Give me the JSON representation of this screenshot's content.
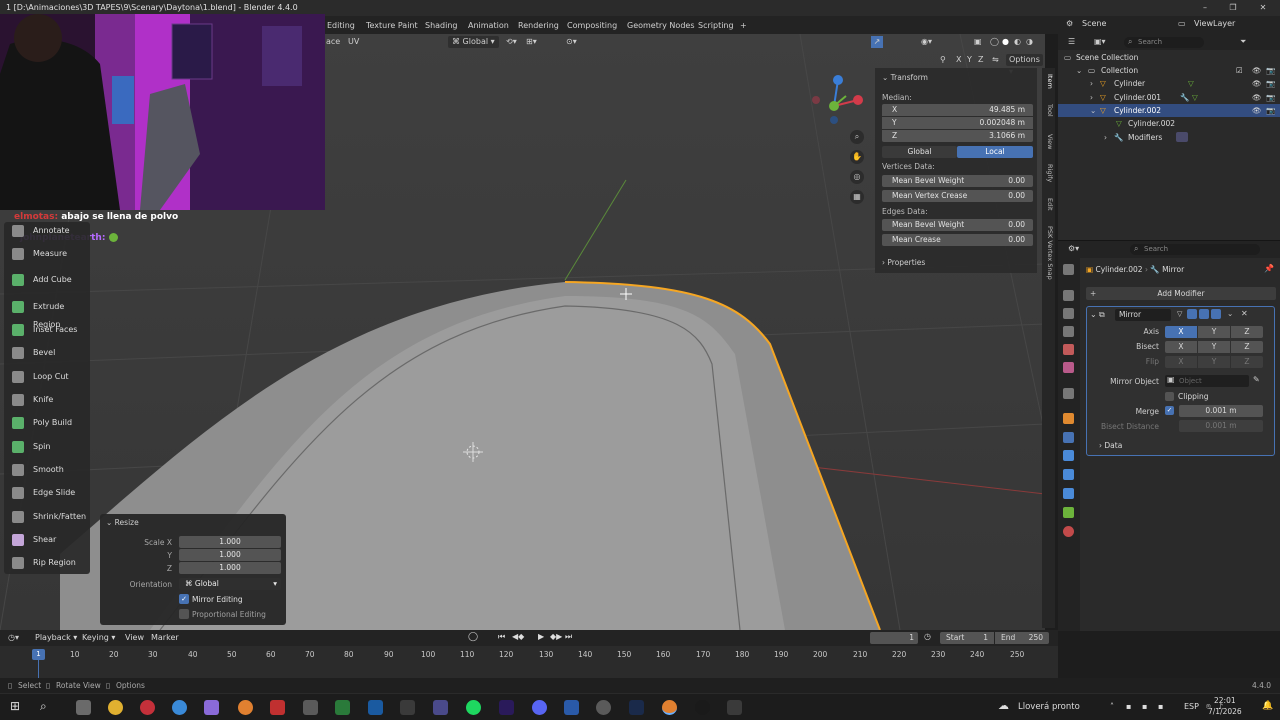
{
  "title": "1 [D:\\Animaciones\\3D TAPES\\9\\Scenary\\Daytona\\1.blend] - Blender 4.4.0",
  "workspace_tabs": [
    "Editing",
    "Texture Paint",
    "Shading",
    "Animation",
    "Rendering",
    "Compositing",
    "Geometry Nodes",
    "Scripting",
    "+"
  ],
  "viewport_header": {
    "face_select": "ace",
    "uv": "UV",
    "orientation": "Global",
    "options": "Options"
  },
  "chat": {
    "line1_user": "elmotas:",
    "line1_text": "abajo se llena de polvo",
    "line2_user": "johnplanetearth:"
  },
  "tools": [
    {
      "label": "Annotate",
      "icon": "annotate-icon"
    },
    {
      "label": "Measure",
      "icon": "measure-icon"
    },
    {
      "label": "Add Cube",
      "icon": "add-cube-icon"
    },
    {
      "label": "Extrude Region",
      "icon": "extrude-region-icon"
    },
    {
      "label": "Inset Faces",
      "icon": "inset-faces-icon"
    },
    {
      "label": "Bevel",
      "icon": "bevel-icon"
    },
    {
      "label": "Loop Cut",
      "icon": "loop-cut-icon"
    },
    {
      "label": "Knife",
      "icon": "knife-icon"
    },
    {
      "label": "Poly Build",
      "icon": "poly-build-icon"
    },
    {
      "label": "Spin",
      "icon": "spin-icon"
    },
    {
      "label": "Smooth",
      "icon": "smooth-icon"
    },
    {
      "label": "Edge Slide",
      "icon": "edge-slide-icon"
    },
    {
      "label": "Shrink/Fatten",
      "icon": "shrink-fatten-icon"
    },
    {
      "label": "Shear",
      "icon": "shear-icon"
    },
    {
      "label": "Rip Region",
      "icon": "rip-region-icon"
    }
  ],
  "resize_panel": {
    "title": "Resize",
    "scale_x_label": "Scale X",
    "scale_x": "1.000",
    "y_label": "Y",
    "scale_y": "1.000",
    "z_label": "Z",
    "scale_z": "1.000",
    "orientation_label": "Orientation",
    "orientation": "Global",
    "mirror_editing": "Mirror Editing",
    "proportional_editing": "Proportional Editing"
  },
  "transform_panel": {
    "title": "Transform",
    "median_label": "Median:",
    "x_label": "X",
    "x": "49.485 m",
    "y_label": "Y",
    "y": "0.002048 m",
    "z_label": "Z",
    "z": "3.1066 m",
    "global": "Global",
    "local": "Local",
    "vertices_data": "Vertices Data:",
    "mean_bevel_weight_v": "Mean Bevel Weight",
    "mean_bevel_weight_v_val": "0.00",
    "mean_vertex_crease": "Mean Vertex Crease",
    "mean_vertex_crease_val": "0.00",
    "edges_data": "Edges Data:",
    "mean_bevel_weight_e": "Mean Bevel Weight",
    "mean_bevel_weight_e_val": "0.00",
    "mean_crease": "Mean Crease",
    "mean_crease_val": "0.00",
    "properties": "Properties"
  },
  "side_tabs": [
    "Item",
    "Tool",
    "View",
    "Rigify",
    "Edit",
    "PSK Vertex Snap"
  ],
  "outliner": {
    "scene": "Scene",
    "view_layer": "ViewLayer",
    "search": "Search",
    "scene_collection": "Scene Collection",
    "collection": "Collection",
    "items": [
      "Cylinder",
      "Cylinder.001",
      "Cylinder.002"
    ],
    "mesh": "Cylinder.002",
    "modifiers": "Modifiers"
  },
  "properties": {
    "search": "Search",
    "breadcrumb_object": "Cylinder.002",
    "breadcrumb_modifier": "Mirror",
    "add_modifier": "Add Modifier",
    "modifier_name": "Mirror",
    "axis_label": "Axis",
    "bisect_label": "Bisect",
    "flip_label": "Flip",
    "x": "X",
    "y": "Y",
    "z": "Z",
    "mirror_object_label": "Mirror Object",
    "mirror_object_placeholder": "Object",
    "clipping": "Clipping",
    "merge_label": "Merge",
    "merge_value": "0.001 m",
    "bisect_distance_label": "Bisect Distance",
    "bisect_distance_value": "0.001 m",
    "data": "Data"
  },
  "timeline": {
    "menu": [
      "Playback",
      "Keying",
      "View",
      "Marker"
    ],
    "current_frame": "1",
    "start_label": "Start",
    "start": "1",
    "end_label": "End",
    "end": "250",
    "frames": [
      "1",
      "10",
      "20",
      "30",
      "40",
      "50",
      "60",
      "70",
      "80",
      "90",
      "100",
      "110",
      "120",
      "130",
      "140",
      "150",
      "160",
      "170",
      "180",
      "190",
      "200",
      "210",
      "220",
      "230",
      "240",
      "250"
    ]
  },
  "status": {
    "select": "Select",
    "rotate": "Rotate View",
    "options": "Options",
    "version": "4.4.0"
  },
  "taskbar": {
    "weather": "Lloverá pronto",
    "lang": "ESP",
    "time": "22:01",
    "date": "7/1/2026"
  },
  "colors": {
    "accent": "#4772b3",
    "selection": "#f5a623",
    "header": "#232323"
  }
}
